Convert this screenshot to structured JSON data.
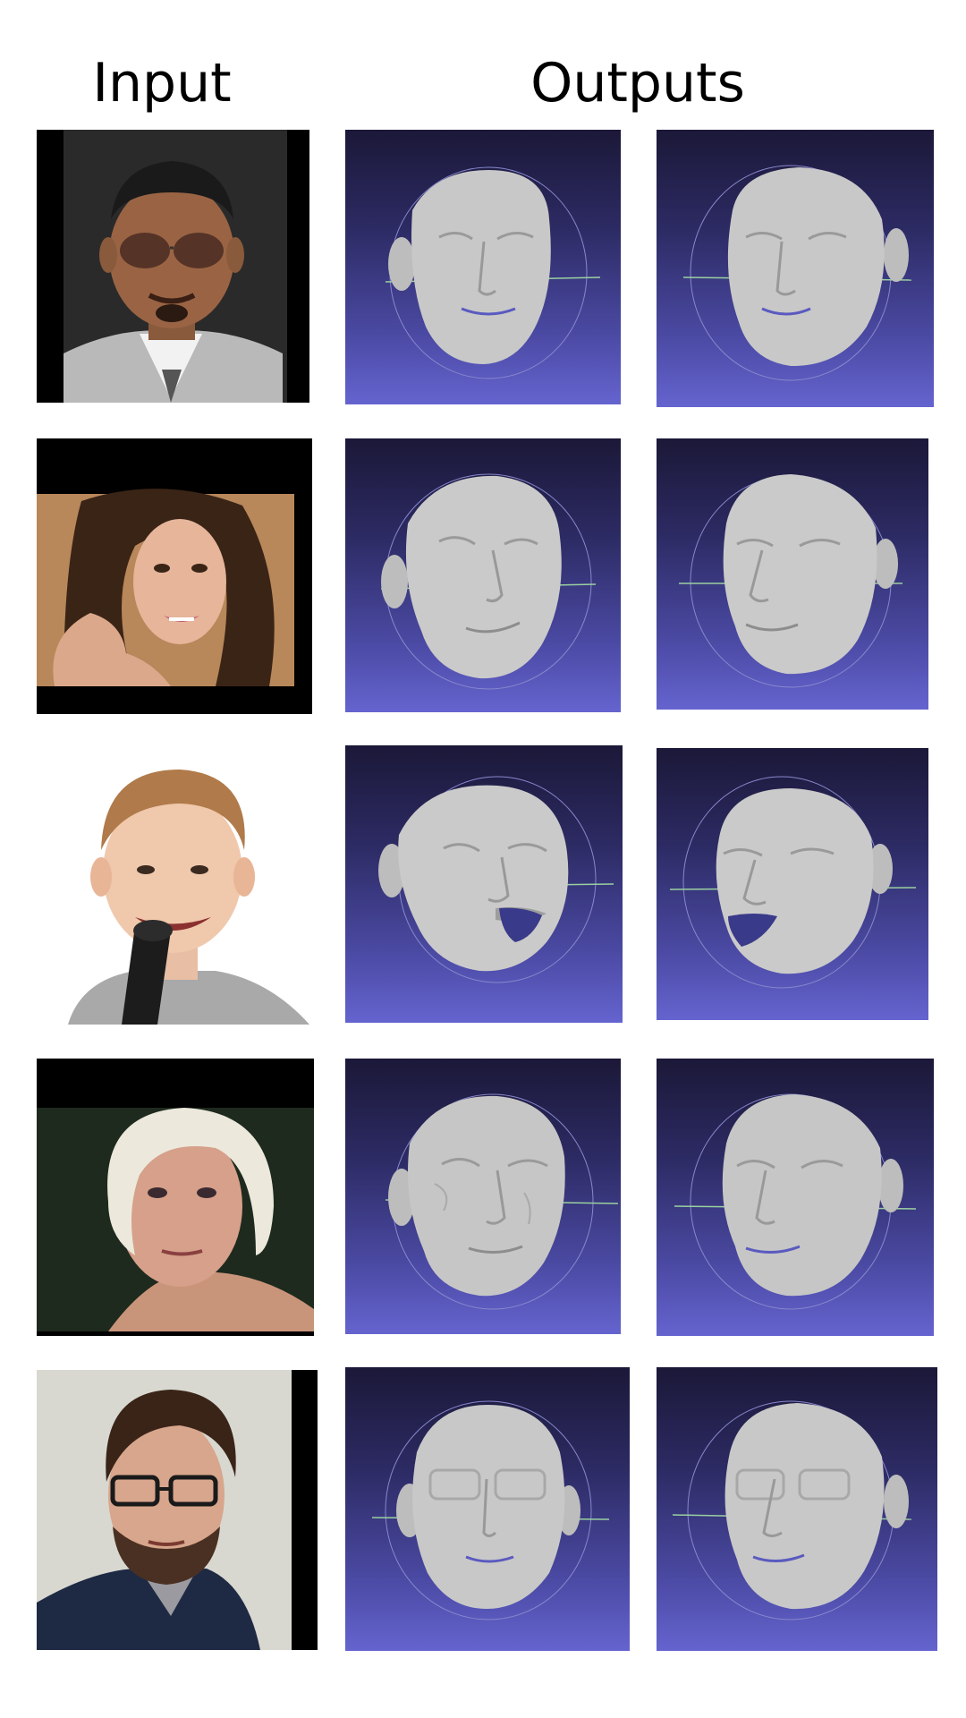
{
  "headers": {
    "input": "Input",
    "outputs": "Outputs"
  },
  "rows": [
    {
      "subject": "man-with-sunglasses",
      "expression": "neutral",
      "input_background": "black-border"
    },
    {
      "subject": "woman-with-brown-hair",
      "expression": "smile",
      "input_background": "black-border"
    },
    {
      "subject": "boy-with-microphone",
      "expression": "open-mouth",
      "input_background": "white"
    },
    {
      "subject": "elderly-woman",
      "expression": "neutral",
      "input_background": "black-border"
    },
    {
      "subject": "man-with-glasses-and-beard",
      "expression": "neutral",
      "input_background": "black-border"
    }
  ],
  "colors": {
    "render_top": "#1b1838",
    "render_bottom": "#6564cf",
    "mesh": "#c8c8c8"
  }
}
